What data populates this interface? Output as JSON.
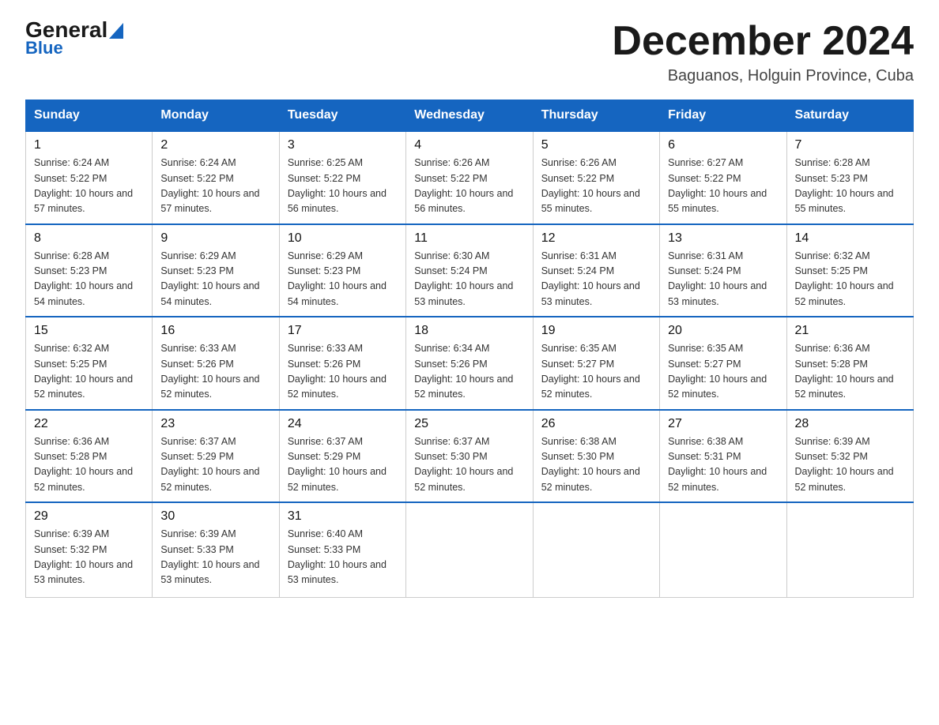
{
  "header": {
    "logo_general": "General",
    "logo_blue": "Blue",
    "month_title": "December 2024",
    "subtitle": "Baguanos, Holguin Province, Cuba"
  },
  "days_of_week": [
    "Sunday",
    "Monday",
    "Tuesday",
    "Wednesday",
    "Thursday",
    "Friday",
    "Saturday"
  ],
  "weeks": [
    [
      {
        "day": "1",
        "sunrise": "6:24 AM",
        "sunset": "5:22 PM",
        "daylight": "10 hours and 57 minutes."
      },
      {
        "day": "2",
        "sunrise": "6:24 AM",
        "sunset": "5:22 PM",
        "daylight": "10 hours and 57 minutes."
      },
      {
        "day": "3",
        "sunrise": "6:25 AM",
        "sunset": "5:22 PM",
        "daylight": "10 hours and 56 minutes."
      },
      {
        "day": "4",
        "sunrise": "6:26 AM",
        "sunset": "5:22 PM",
        "daylight": "10 hours and 56 minutes."
      },
      {
        "day": "5",
        "sunrise": "6:26 AM",
        "sunset": "5:22 PM",
        "daylight": "10 hours and 55 minutes."
      },
      {
        "day": "6",
        "sunrise": "6:27 AM",
        "sunset": "5:22 PM",
        "daylight": "10 hours and 55 minutes."
      },
      {
        "day": "7",
        "sunrise": "6:28 AM",
        "sunset": "5:23 PM",
        "daylight": "10 hours and 55 minutes."
      }
    ],
    [
      {
        "day": "8",
        "sunrise": "6:28 AM",
        "sunset": "5:23 PM",
        "daylight": "10 hours and 54 minutes."
      },
      {
        "day": "9",
        "sunrise": "6:29 AM",
        "sunset": "5:23 PM",
        "daylight": "10 hours and 54 minutes."
      },
      {
        "day": "10",
        "sunrise": "6:29 AM",
        "sunset": "5:23 PM",
        "daylight": "10 hours and 54 minutes."
      },
      {
        "day": "11",
        "sunrise": "6:30 AM",
        "sunset": "5:24 PM",
        "daylight": "10 hours and 53 minutes."
      },
      {
        "day": "12",
        "sunrise": "6:31 AM",
        "sunset": "5:24 PM",
        "daylight": "10 hours and 53 minutes."
      },
      {
        "day": "13",
        "sunrise": "6:31 AM",
        "sunset": "5:24 PM",
        "daylight": "10 hours and 53 minutes."
      },
      {
        "day": "14",
        "sunrise": "6:32 AM",
        "sunset": "5:25 PM",
        "daylight": "10 hours and 52 minutes."
      }
    ],
    [
      {
        "day": "15",
        "sunrise": "6:32 AM",
        "sunset": "5:25 PM",
        "daylight": "10 hours and 52 minutes."
      },
      {
        "day": "16",
        "sunrise": "6:33 AM",
        "sunset": "5:26 PM",
        "daylight": "10 hours and 52 minutes."
      },
      {
        "day": "17",
        "sunrise": "6:33 AM",
        "sunset": "5:26 PM",
        "daylight": "10 hours and 52 minutes."
      },
      {
        "day": "18",
        "sunrise": "6:34 AM",
        "sunset": "5:26 PM",
        "daylight": "10 hours and 52 minutes."
      },
      {
        "day": "19",
        "sunrise": "6:35 AM",
        "sunset": "5:27 PM",
        "daylight": "10 hours and 52 minutes."
      },
      {
        "day": "20",
        "sunrise": "6:35 AM",
        "sunset": "5:27 PM",
        "daylight": "10 hours and 52 minutes."
      },
      {
        "day": "21",
        "sunrise": "6:36 AM",
        "sunset": "5:28 PM",
        "daylight": "10 hours and 52 minutes."
      }
    ],
    [
      {
        "day": "22",
        "sunrise": "6:36 AM",
        "sunset": "5:28 PM",
        "daylight": "10 hours and 52 minutes."
      },
      {
        "day": "23",
        "sunrise": "6:37 AM",
        "sunset": "5:29 PM",
        "daylight": "10 hours and 52 minutes."
      },
      {
        "day": "24",
        "sunrise": "6:37 AM",
        "sunset": "5:29 PM",
        "daylight": "10 hours and 52 minutes."
      },
      {
        "day": "25",
        "sunrise": "6:37 AM",
        "sunset": "5:30 PM",
        "daylight": "10 hours and 52 minutes."
      },
      {
        "day": "26",
        "sunrise": "6:38 AM",
        "sunset": "5:30 PM",
        "daylight": "10 hours and 52 minutes."
      },
      {
        "day": "27",
        "sunrise": "6:38 AM",
        "sunset": "5:31 PM",
        "daylight": "10 hours and 52 minutes."
      },
      {
        "day": "28",
        "sunrise": "6:39 AM",
        "sunset": "5:32 PM",
        "daylight": "10 hours and 52 minutes."
      }
    ],
    [
      {
        "day": "29",
        "sunrise": "6:39 AM",
        "sunset": "5:32 PM",
        "daylight": "10 hours and 53 minutes."
      },
      {
        "day": "30",
        "sunrise": "6:39 AM",
        "sunset": "5:33 PM",
        "daylight": "10 hours and 53 minutes."
      },
      {
        "day": "31",
        "sunrise": "6:40 AM",
        "sunset": "5:33 PM",
        "daylight": "10 hours and 53 minutes."
      },
      null,
      null,
      null,
      null
    ]
  ]
}
